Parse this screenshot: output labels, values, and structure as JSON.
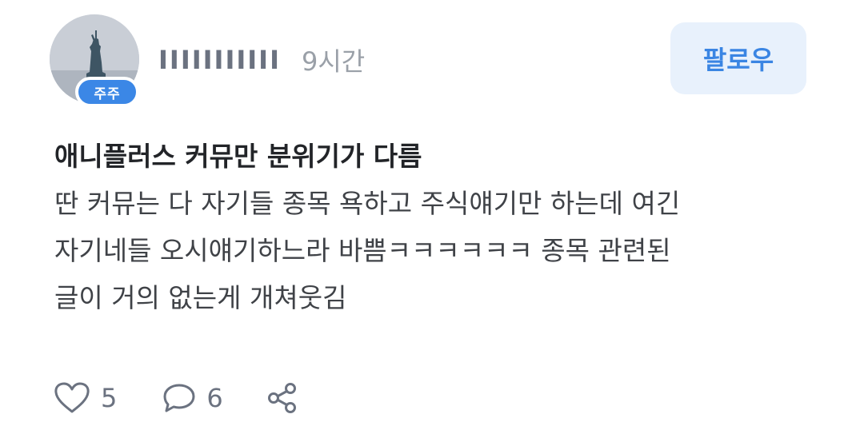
{
  "author": {
    "name": "IIIIIIIIIII",
    "badge": "주주",
    "avatar_icon": "statue-of-liberty-avatar"
  },
  "post": {
    "time": "9시간",
    "title": "애니플러스 커뮤만 분위기가 다름",
    "body_lines": [
      "딴 커뮤는 다 자기들 종목 욕하고 주식얘기만 하는데 여긴",
      "자기네들 오시얘기하느라 바쁨ㅋㅋㅋㅋㅋㅋ 종목 관련된",
      "글이 거의 없는게 개쳐웃김"
    ]
  },
  "follow_label": "팔로우",
  "actions": {
    "likes": "5",
    "comments": "6",
    "like_icon": "heart-icon",
    "comment_icon": "comment-icon",
    "share_icon": "share-icon"
  },
  "colors": {
    "accent": "#3a85e3",
    "follow_bg": "#e8f1fc",
    "badge_bg": "#3b87e6",
    "muted_text": "#6b7280",
    "title_text": "#222428",
    "body_text": "#3f4247"
  }
}
